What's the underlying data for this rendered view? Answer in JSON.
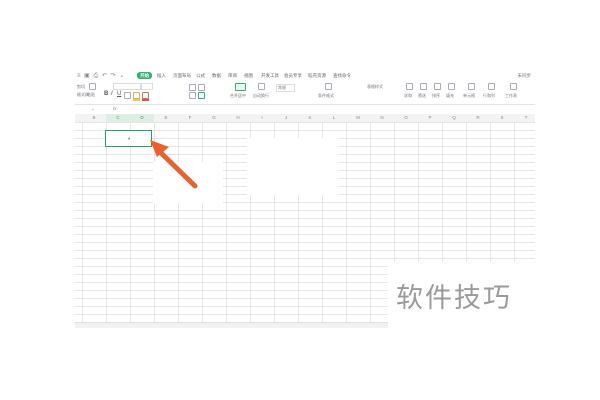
{
  "menu": {
    "quick_access": "≡ ▣ ⎙ ↶ ↷ ⌄",
    "active_tab": "开始",
    "tabs": [
      "插入",
      "页面布局",
      "公式",
      "数据",
      "审阅",
      "视图",
      "开发工具",
      "会员专享",
      "稻壳资源",
      "查找命令"
    ],
    "right_action": "未同步"
  },
  "ribbon": {
    "paste_label": "粘贴",
    "format_painter_label": "格式刷",
    "cut_label": "剪切",
    "bold": "B",
    "italic": "I",
    "underline": "U",
    "merge_label": "合并居中",
    "wrap_label": "自动换行",
    "number_format": "常规",
    "conditional_format_label": "条件格式",
    "table_style_label": "表格样式",
    "sum_label": "求和",
    "filter_label": "筛选",
    "sort_label": "排序",
    "fill_label": "填充",
    "cell_label": "单元格",
    "row_col_label": "行和列",
    "worksheet_label": "工作表"
  },
  "formula_bar": {
    "fx": "fx"
  },
  "columns": [
    "B",
    "C",
    "D",
    "E",
    "F",
    "G",
    "H",
    "I",
    "J",
    "K",
    "L",
    "M",
    "N",
    "O",
    "P",
    "Q",
    "R",
    "S",
    "T"
  ],
  "selected_columns": [
    "C",
    "D"
  ],
  "watermark": "软件技巧",
  "colors": {
    "accent": "#2db36f",
    "selection_border": "#26a269",
    "arrow": "#e8622f"
  }
}
